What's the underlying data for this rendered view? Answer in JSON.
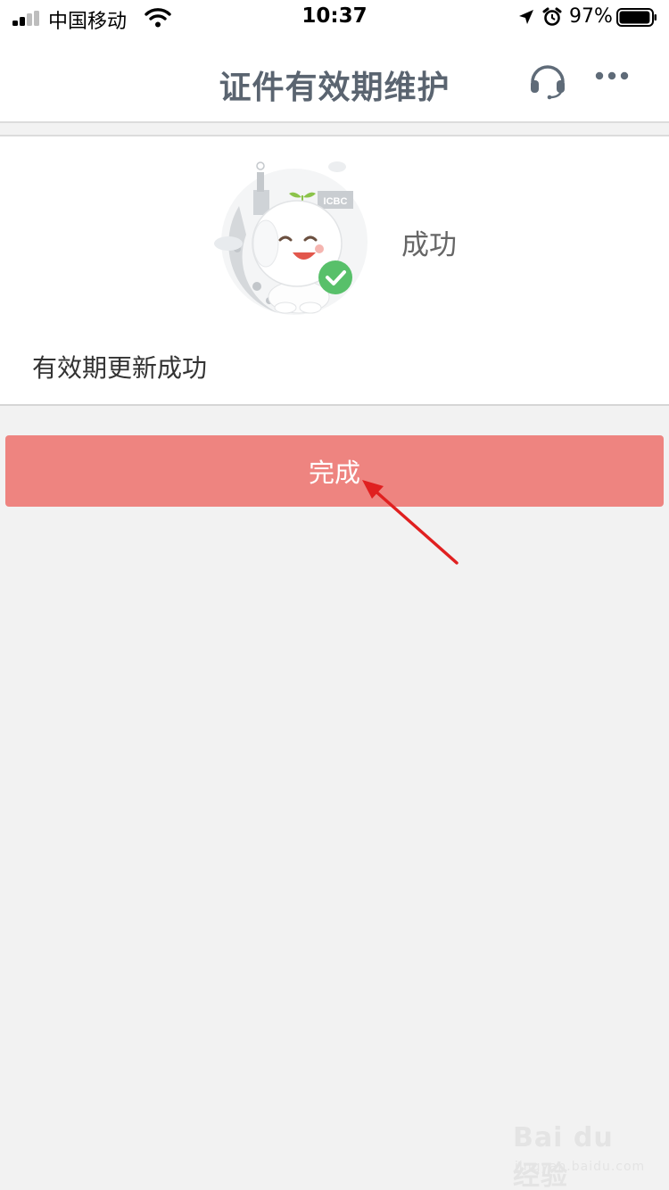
{
  "status_bar": {
    "carrier": "中国移动",
    "time": "10:37",
    "battery_percent": "97%",
    "battery_level": 0.97,
    "icons": [
      "signal-icon",
      "wifi-icon",
      "location-icon",
      "alarm-icon",
      "battery-icon"
    ]
  },
  "nav": {
    "title": "证件有效期维护",
    "icons": [
      "headset-icon",
      "more-icon"
    ]
  },
  "result": {
    "status_label": "成功",
    "message": "有效期更新成功",
    "mascot_badge": "ICBC",
    "check_color": "#58c06a"
  },
  "actions": {
    "done_label": "完成",
    "done_color": "#ee8480"
  },
  "annotation": {
    "arrow_color": "#e02020"
  },
  "watermark": {
    "main": "Bai du 经验",
    "sub": "jingyan.baidu.com"
  }
}
